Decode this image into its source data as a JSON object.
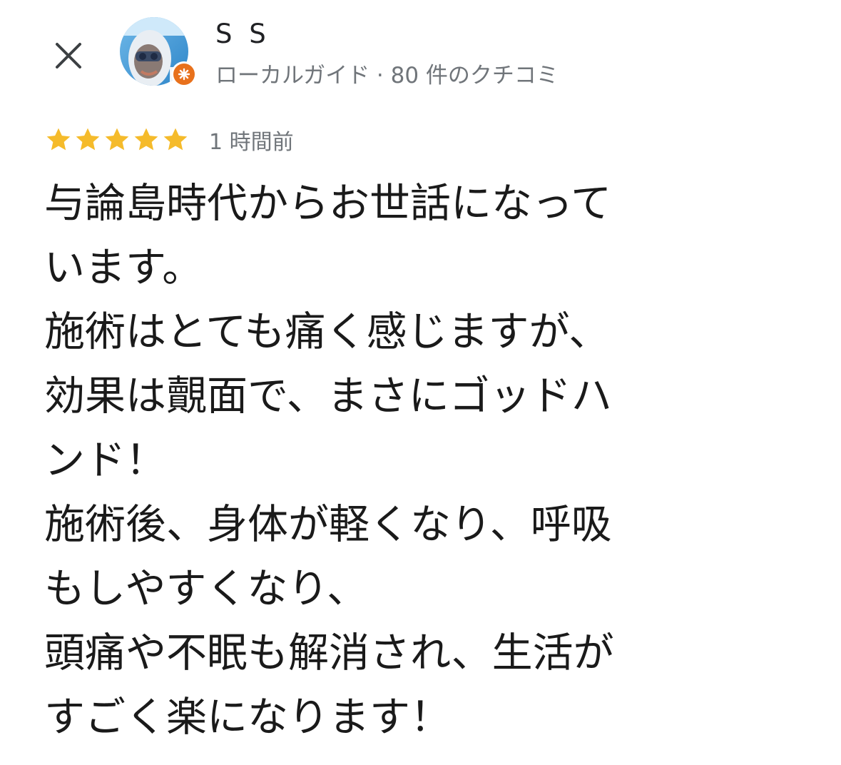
{
  "header": {
    "close_icon": "close-icon",
    "user_name": "S S",
    "user_meta": "ローカルガイド · 80 件のクチコミ",
    "avatar_icon": "user-avatar",
    "badge_icon": "local-guide-star-icon",
    "badge_color": "#e8711c"
  },
  "review": {
    "rating": 5,
    "max_rating": 5,
    "star_color": "#f5bb2b",
    "time_ago": "1 時間前",
    "lines": [
      "与論島時代からお世話になって",
      "います。",
      "施術はとても痛く感じますが、",
      "効果は覿面で、まさにゴッドハ",
      "ンド！",
      "施術後、身体が軽くなり、呼吸",
      "もしやすくなり、",
      "頭痛や不眠も解消され、生活が",
      "すごく楽になります！"
    ]
  }
}
